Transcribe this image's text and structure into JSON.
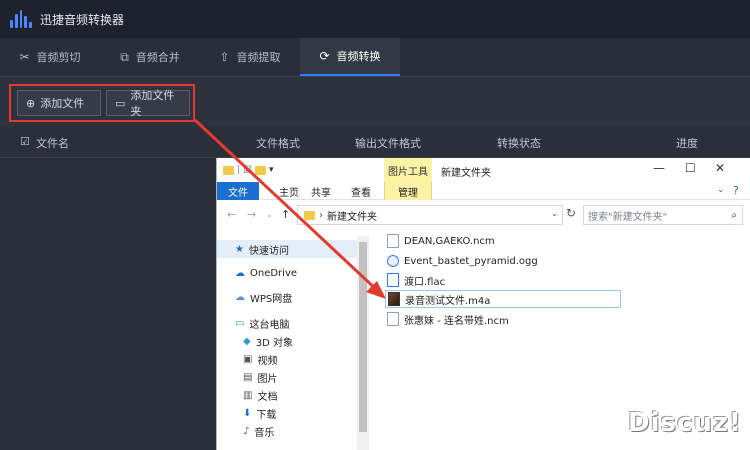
{
  "app": {
    "title": "迅捷音频转换器"
  },
  "tabs": [
    {
      "label": "音频剪切",
      "icon": "scissors-icon",
      "active": false
    },
    {
      "label": "音频合并",
      "icon": "merge-icon",
      "active": false
    },
    {
      "label": "音频提取",
      "icon": "extract-icon",
      "active": false
    },
    {
      "label": "音频转换",
      "icon": "convert-icon",
      "active": true
    }
  ],
  "toolbar": {
    "add_file": "添加文件",
    "add_folder": "添加文件夹"
  },
  "columns": {
    "name": "文件名",
    "format": "文件格式",
    "output_format": "输出文件格式",
    "status": "转换状态",
    "progress": "进度"
  },
  "explorer": {
    "context_tab": "图片工具",
    "window_title": "新建文件夹",
    "menu": {
      "file": "文件",
      "home": "主页",
      "share": "共享",
      "view": "查看",
      "manage": "管理"
    },
    "address": "新建文件夹",
    "search_placeholder": "搜索\"新建文件夹\"",
    "nav": [
      {
        "label": "快速访问",
        "icon": "star-icon"
      },
      {
        "label": "OneDrive",
        "icon": "cloud-icon"
      },
      {
        "label": "WPS网盘",
        "icon": "cloud-icon"
      },
      {
        "label": "这台电脑",
        "icon": "computer-icon"
      },
      {
        "label": "3D 对象",
        "icon": "cube-icon"
      },
      {
        "label": "视频",
        "icon": "video-icon"
      },
      {
        "label": "图片",
        "icon": "picture-icon"
      },
      {
        "label": "文档",
        "icon": "document-icon"
      },
      {
        "label": "下载",
        "icon": "download-icon"
      },
      {
        "label": "音乐",
        "icon": "music-icon"
      }
    ],
    "files": [
      {
        "name": "DEAN,GAEKO.ncm",
        "selected": false
      },
      {
        "name": "Event_bastet_pyramid.ogg",
        "selected": false
      },
      {
        "name": "渡口.flac",
        "selected": false
      },
      {
        "name": "录音测试文件.m4a",
        "selected": true
      },
      {
        "name": "张惠妹 - 连名带姓.ncm",
        "selected": false
      }
    ]
  },
  "watermark": "Discuz!",
  "colors": {
    "accent": "#2f7bff",
    "highlight": "#e33a2f",
    "app_bg": "#2b2f3a"
  }
}
